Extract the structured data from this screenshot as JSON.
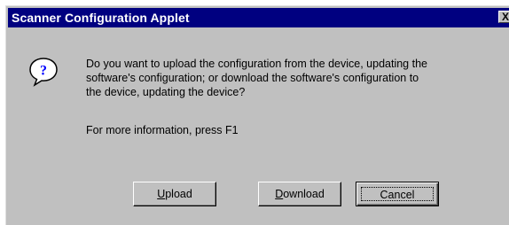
{
  "dialog": {
    "title": "Scanner Configuration Applet",
    "close_label": "X",
    "icon": "question-icon",
    "message_lines": [
      "Do you want to upload the configuration from the device, updating the",
      "software's configuration; or download the software's configuration to",
      "the device, updating the device?"
    ],
    "info": "For more information, press F1",
    "buttons": {
      "upload": {
        "mnemonic": "U",
        "rest": "pload"
      },
      "download": {
        "mnemonic": "D",
        "rest": "ownload"
      },
      "cancel": {
        "label": "Cancel"
      }
    }
  },
  "colors": {
    "titlebar": "#000080",
    "face": "#c0c0c0"
  }
}
